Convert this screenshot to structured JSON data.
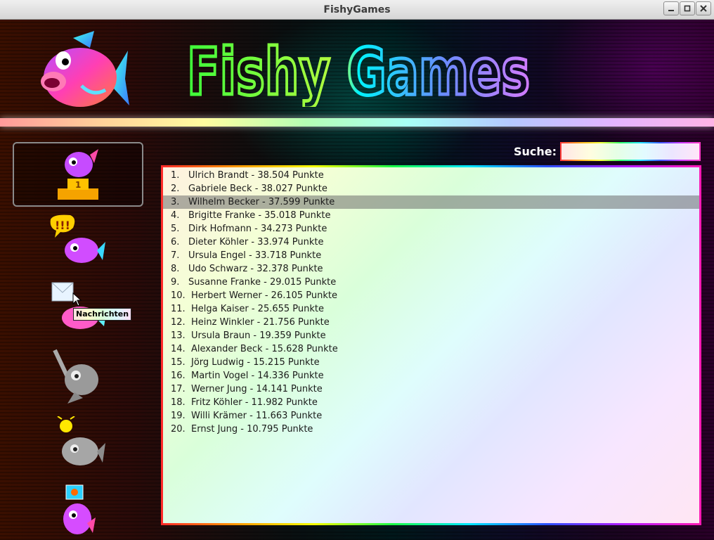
{
  "window": {
    "title": "FishyGames",
    "buttons": [
      "minimize-icon",
      "maximize-icon",
      "close-icon"
    ]
  },
  "header": {
    "logo_text": "Fishy Games",
    "logo_icon": "fish-mascot-icon"
  },
  "sidebar": {
    "items": [
      {
        "name": "highscore",
        "icon": "trophy-fish-icon",
        "selected": true
      },
      {
        "name": "forum",
        "icon": "exclamation-fish-icon",
        "selected": false
      },
      {
        "name": "messages",
        "icon": "envelope-fish-icon",
        "selected": false
      },
      {
        "name": "disabled-1",
        "icon": "bat-fish-icon",
        "selected": false
      },
      {
        "name": "disabled-2",
        "icon": "lightbulb-fish-icon",
        "selected": false
      },
      {
        "name": "profile",
        "icon": "picture-fish-icon",
        "selected": false
      }
    ],
    "tooltip": "Nachrichten"
  },
  "search": {
    "label": "Suche:",
    "value": ""
  },
  "ranking": {
    "selected_index": 3,
    "entries": [
      {
        "rank": "1.",
        "text": "Ulrich Brandt - 38.504 Punkte"
      },
      {
        "rank": "2.",
        "text": "Gabriele Beck - 38.027 Punkte"
      },
      {
        "rank": "3.",
        "text": "Wilhelm Becker - 37.599 Punkte"
      },
      {
        "rank": "4.",
        "text": "Brigitte Franke - 35.018 Punkte"
      },
      {
        "rank": "5.",
        "text": "Dirk Hofmann - 34.273 Punkte"
      },
      {
        "rank": "6.",
        "text": "Dieter Köhler - 33.974 Punkte"
      },
      {
        "rank": "7.",
        "text": "Ursula Engel - 33.718 Punkte"
      },
      {
        "rank": "8.",
        "text": "Udo Schwarz - 32.378 Punkte"
      },
      {
        "rank": "9.",
        "text": "Susanne Franke - 29.015 Punkte"
      },
      {
        "rank": "10.",
        "text": "Herbert Werner - 26.105 Punkte"
      },
      {
        "rank": "11.",
        "text": "Helga Kaiser - 25.655 Punkte"
      },
      {
        "rank": "12.",
        "text": "Heinz Winkler - 21.756 Punkte"
      },
      {
        "rank": "13.",
        "text": "Ursula Braun - 19.359 Punkte"
      },
      {
        "rank": "14.",
        "text": "Alexander Beck - 15.628 Punkte"
      },
      {
        "rank": "15.",
        "text": "Jörg Ludwig - 15.215 Punkte"
      },
      {
        "rank": "16.",
        "text": "Martin Vogel - 14.336 Punkte"
      },
      {
        "rank": "17.",
        "text": "Werner Jung - 14.141 Punkte"
      },
      {
        "rank": "18.",
        "text": "Fritz Köhler - 11.982 Punkte"
      },
      {
        "rank": "19.",
        "text": "Willi Krämer - 11.663 Punkte"
      },
      {
        "rank": "20.",
        "text": "Ernst Jung - 10.795 Punkte"
      }
    ]
  },
  "colors": {
    "accent": "#2bff4a",
    "title_glow": "#00e8ff",
    "selection": "#6e6e6e"
  }
}
